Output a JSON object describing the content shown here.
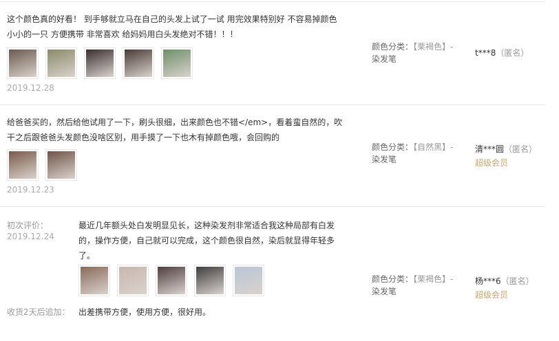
{
  "reviews": [
    {
      "text": "这个颜色真的好看！ 到手够就立马在自己的头发上试了一试 用完效果特别好 不容易掉颜色 小小的一只 方便携带 非常喜欢 给妈妈用白头发绝对不错！！！",
      "photos": [
        {
          "icon": "hair-root-photo",
          "color": "#6b5a4e"
        },
        {
          "icon": "product-pen-photo",
          "color": "#8a8a6a"
        },
        {
          "icon": "woman-selfie-photo",
          "color": "#3b2f2f"
        },
        {
          "icon": "woman-selfie-photo",
          "color": "#4a3b36"
        },
        {
          "icon": "product-pen-photo",
          "color": "#6f8f6a"
        }
      ],
      "date": "2019.12.28",
      "sku_label": "颜色分类：",
      "sku_value": "【栗褐色】-",
      "sku_value2": "染发笔",
      "user": "t***8",
      "anon": "（匿名）",
      "vip": ""
    },
    {
      "text": "给爸爸买的，然后给他试用了一下，刷头很细，出来颜色也不错</em>，看着蛮自然的，吹干之后跟爸爸头发颜色没啥区别，用手摸了一下也木有掉颜色哦，会回购的",
      "photos": [
        {
          "icon": "product-box-photo",
          "color": "#7a5a4a"
        },
        {
          "icon": "product-box-photo",
          "color": "#6e5448"
        }
      ],
      "date": "2019.12.23",
      "sku_label": "颜色分类：",
      "sku_value": "【自然黑】-",
      "sku_value2": "染发笔",
      "user": "清***圆",
      "anon": "（匿名）",
      "vip": "超级会员"
    },
    {
      "initial_label": "初次评价：",
      "initial_date": "2019.12.24",
      "text": "最近几年额头处白发明显见长，这种染发剂非常适合我这种局部有白发的，操作方便，自己就可以完成，这个颜色很自然，染后就显得年轻多了。",
      "photos": [
        {
          "icon": "product-pen-photo",
          "color": "#8a6a5a"
        },
        {
          "icon": "hair-photo",
          "color": "#c9b7ae"
        },
        {
          "icon": "product-box-photo",
          "color": "#4e3e3e"
        },
        {
          "icon": "hair-photo",
          "color": "#3e3e3e"
        },
        {
          "icon": "woman-selfie-photo",
          "color": "#b9c6d6"
        }
      ],
      "append_label": "收货2天后追加：",
      "append_text": "出差携带方便，使用方便，很好用。",
      "sku_label": "颜色分类：",
      "sku_value": "【栗褐色】-",
      "sku_value2": "染发笔",
      "user": "杨***6",
      "anon": "（匿名）",
      "vip": "超级会员"
    }
  ]
}
